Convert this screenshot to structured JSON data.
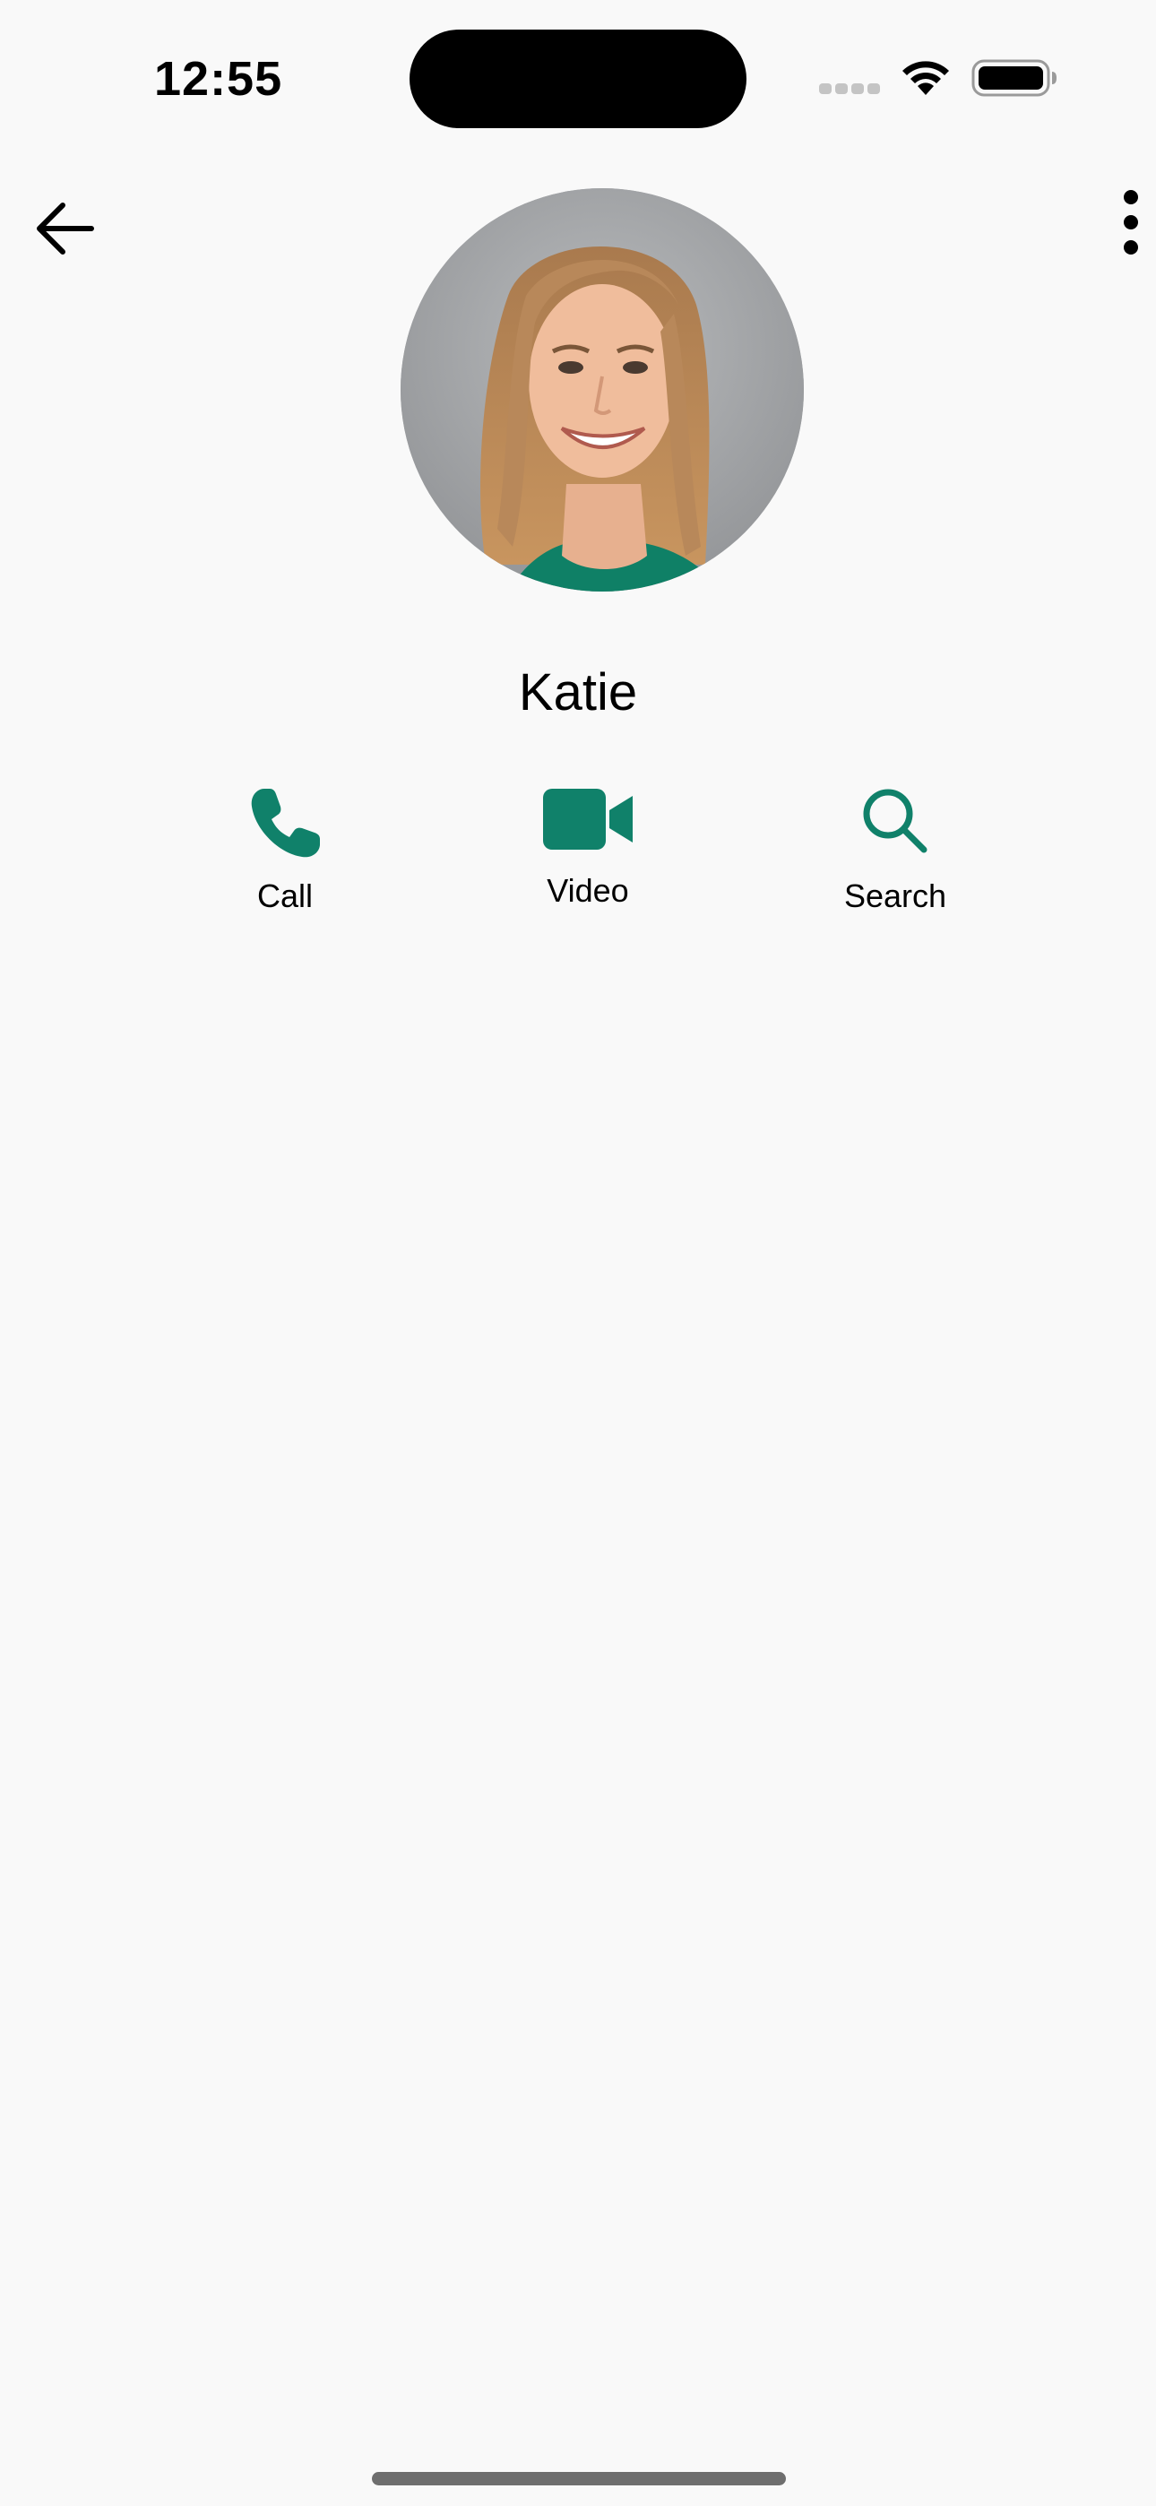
{
  "status_bar": {
    "time": "12:55"
  },
  "contact": {
    "name": "Katie"
  },
  "actions": [
    {
      "label": "Call",
      "icon": "phone-icon"
    },
    {
      "label": "Video",
      "icon": "video-camera-icon"
    },
    {
      "label": "Search",
      "icon": "search-icon"
    }
  ],
  "colors": {
    "accent": "#10816a",
    "background": "#f9f9f9",
    "text": "#000000"
  }
}
